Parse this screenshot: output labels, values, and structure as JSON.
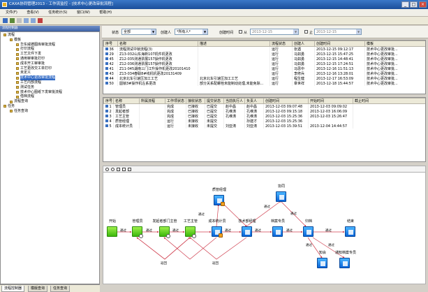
{
  "window": {
    "title": "CAXA协同管理2013 - 工作流监控 - [技术中心更改审批流程]"
  },
  "menu": [
    "文件(F)",
    "查看(V)",
    "任务统计(S)",
    "窗口(W)",
    "帮助(H)"
  ],
  "left_panel": {
    "header": "流程控制器",
    "tree": [
      {
        "label": "流程",
        "level": 0
      },
      {
        "label": "模板",
        "level": 1
      },
      {
        "label": "华东威德图库审批流程",
        "level": 2
      },
      {
        "label": "打印流程",
        "level": 2
      },
      {
        "label": "工艺文件下发",
        "level": 2
      },
      {
        "label": "通用审审批打印",
        "level": 2
      },
      {
        "label": "成本开工审审批",
        "level": 2
      },
      {
        "label": "工艺更改交工单打印",
        "level": 2
      },
      {
        "label": "未定义",
        "level": 2
      },
      {
        "label": "技术中心更改审批流程",
        "level": 2,
        "selected": true
      },
      {
        "label": "工艺内部流程",
        "level": 2
      },
      {
        "label": "测试任务",
        "level": 2
      },
      {
        "label": "技术中心图纸下发审批流程",
        "level": 2
      },
      {
        "label": "借档流程",
        "level": 2
      },
      {
        "label": "流程查询",
        "level": 1
      },
      {
        "label": "任务",
        "level": 0
      },
      {
        "label": "任务查询",
        "level": 1
      }
    ],
    "bottom_tabs": [
      "流程控制器",
      "模版查询",
      "任务查询"
    ]
  },
  "filter": {
    "status_label": "状态",
    "status_value": "全部",
    "creator_label": "创建人",
    "creator_value": "*所有人*",
    "created_time_label": "创建时间",
    "from_label": "从",
    "from_value": "2013-12-15",
    "to_label": "止",
    "to_value": "2013-12-15"
  },
  "process_table": {
    "columns": [
      "序号",
      "名称",
      "描述",
      "流程状态",
      "创建人",
      "创建时间",
      "模板"
    ],
    "rows": [
      [
        "36",
        "流程测试中锁流程(3)",
        "",
        "运行",
        "张遇",
        "2013-12-15 09:12:17",
        "技术中心更改审批..."
      ],
      [
        "29",
        "Z13-032山东海新107机件机更改",
        "",
        "运行",
        "马如勇",
        "2013-12-15 15:47:25",
        "技术中心更改审批..."
      ],
      [
        "45",
        "Z12-035测通票展157操作机更改",
        "",
        "运行",
        "马如勇",
        "2013-12-15 14:48:41",
        "技术中心更改审批..."
      ],
      [
        "42",
        "Z12-036测通票展157操作机更改",
        "",
        "运行",
        "马如勇",
        "2013-12-15 17:24:51",
        "技术中心更改审批..."
      ],
      [
        "41",
        "Z11-045湖南三门江升操作机更改20101410",
        "",
        "运行",
        "马思中",
        "2013-12-16 11:51:13",
        "技术中心更改审批..."
      ],
      [
        "43",
        "Z13-034春联8#线机机更改20131409",
        "",
        "运行",
        "李修兵",
        "2013-12-16 13:28:01",
        "技术中心更改审批..."
      ],
      [
        "44",
        "北京北车引速压加工工艺",
        "北京北车引速压加工工艺",
        "运行",
        "程生健",
        "2013-12-17 16:53:09",
        "技术中心更改审批..."
      ],
      [
        "50",
        "圆锁3#操作机左系更改",
        "部分关系配螺栓未能制动处理,未能免除...",
        "运行",
        "章世祥",
        "2013-12-18 15:44:57",
        "技术中心更改审批..."
      ]
    ]
  },
  "task_table": {
    "columns": [
      "序号",
      "名称",
      "所属流程",
      "工作项状态",
      "接收状态",
      "提交状态",
      "当前执行人",
      "负责人",
      "创建时间",
      "开始时间",
      "截止时间"
    ],
    "rows": [
      [
        "1",
        "管理员",
        "",
        "完成",
        "已接收",
        "已提交",
        "赵中昌",
        "赵中昌",
        "2013-12-03 09:07:48",
        "2013-12-03 09:09:02",
        ""
      ],
      [
        "2",
        "发起者部",
        "",
        "完成",
        "已接收",
        "已提交",
        "孔维涛",
        "孔维涛",
        "2013-12-03 09:15:18",
        "2013-12-03 16:06:09",
        ""
      ],
      [
        "3",
        "工艺主管",
        "",
        "完成",
        "已接收",
        "已提交",
        "孔维涛",
        "孔维涛",
        "2013-12-03 15:25:36",
        "2013-12-03 15:26:47",
        ""
      ],
      [
        "4",
        "质管经理",
        "",
        "运行",
        "未接收",
        "未提交",
        "",
        "孙建才",
        "2013-12-03 15:25:36",
        "",
        ""
      ],
      [
        "5",
        "成本统计员",
        "",
        "运行",
        "未接收",
        "未提交",
        "刘亚涛",
        "刘亚涛",
        "2013-12-03 15:39:51",
        "2013-12-04 14:44:57",
        ""
      ]
    ]
  },
  "flow": {
    "nodes": {
      "start": "开始",
      "admin": "管理员",
      "dept": "发起者部门主管",
      "craft": "工艺主管",
      "cost": "成本统计员",
      "tech": "技术部经理",
      "archive": "档案专员",
      "end_node": "归档",
      "finish": "结束",
      "quality": "质管经理",
      "cosign": "协同",
      "notify": "知会",
      "notify2": "通知档案专员"
    },
    "edge_labels": {
      "pass": "通过",
      "reject": "返回"
    }
  }
}
